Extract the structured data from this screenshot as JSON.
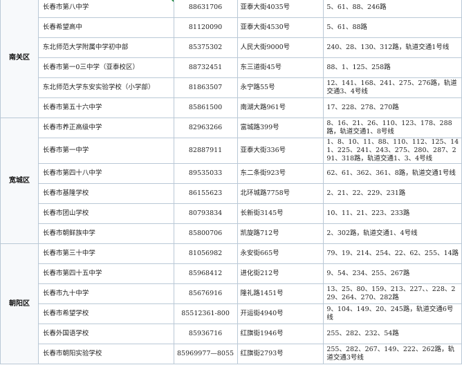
{
  "districts": [
    {
      "name": "南关区",
      "rows": [
        {
          "school": "长春市第八中学",
          "phone": "88631706",
          "address": "亚泰大街4035号",
          "bus": "5、61、88、246路"
        },
        {
          "school": "长春希望高中",
          "phone": "81120090",
          "address": "亚泰大街4530号",
          "bus": "5、61、88路"
        },
        {
          "school": "东北师范大学附属中学初中部",
          "phone": "85375302",
          "address": "人民大街9000号",
          "bus": "240、28、130、312路，轨道交通1号线"
        },
        {
          "school": "长春市第一0三中学（亚泰校区）",
          "phone": "88732451",
          "address": "东三道街45号",
          "bus": "88、1、125、258路"
        },
        {
          "school": "东北师范大学东安实验学校（小学部）",
          "phone": "81863507",
          "address": "永宁路55号",
          "bus": "12、141、168、241、275、276路，轨道交通3、4号线"
        },
        {
          "school": "长春市第五十六中学",
          "phone": "85861500",
          "address": "南湖大路961号",
          "bus": "17、228、278、270路"
        }
      ]
    },
    {
      "name": "宽城区",
      "rows": [
        {
          "school": "长春市养正高级中学",
          "phone": "82963266",
          "address": "富城路399号",
          "bus": "8、16、21、26、110、123、178、288路，轨道交通1、8号线"
        },
        {
          "school": "长春市第一中学",
          "phone": "82887911",
          "address": "亚泰大街336号",
          "bus": "1、8、10、11、88、110、112、125、141、225、241、243、275、280、287、291、318路，轨道交通1、3、4号线"
        },
        {
          "school": "长春市第四十八中学",
          "phone": "89535033",
          "address": "东二条街923号",
          "bus": "62、61、362、361、8路，轨道交通1号线"
        },
        {
          "school": "长春市基隆学校",
          "phone": "86155623",
          "address": "北环城路7758号",
          "bus": "2、21、22、229、231路"
        },
        {
          "school": "长春市团山学校",
          "phone": "80793834",
          "address": "长新街3145号",
          "bus": "10、11、21、223、233路"
        },
        {
          "school": "长春市朝鲜族中学",
          "phone": "85800706",
          "address": "凯旋路712号",
          "bus": "2、302路，轨道交通1、4号线"
        }
      ]
    },
    {
      "name": "朝阳区",
      "rows": [
        {
          "school": "长春市第三十中学",
          "phone": "81056982",
          "address": "永安街665号",
          "bus": "79、19、214、254、22、62、255、14路"
        },
        {
          "school": "长春市第四十五中学",
          "phone": "85968412",
          "address": "进化街212号",
          "bus": "9、54、234、255、267路"
        },
        {
          "school": "长春市九十中学",
          "phone": "85676916",
          "address": "隆礼路1451号",
          "bus": "13、25、80、159、213、227、、228、229、264、270、282路"
        },
        {
          "school": "长春市希望学校",
          "phone": "85512361-800",
          "address": "开运街4940号",
          "bus": "9、104、149、20、245路，轨道交通6号线"
        },
        {
          "school": "长春外国语学校",
          "phone": "85936716",
          "address": "红旗街1946号",
          "bus": "255、282、232、54路"
        },
        {
          "school": "长春市朝阳实验学校",
          "phone": "85969977—8055",
          "address": "红旗街2793号",
          "bus": "255、282、267、149、222、262路，轨道交通3号线"
        }
      ]
    }
  ]
}
